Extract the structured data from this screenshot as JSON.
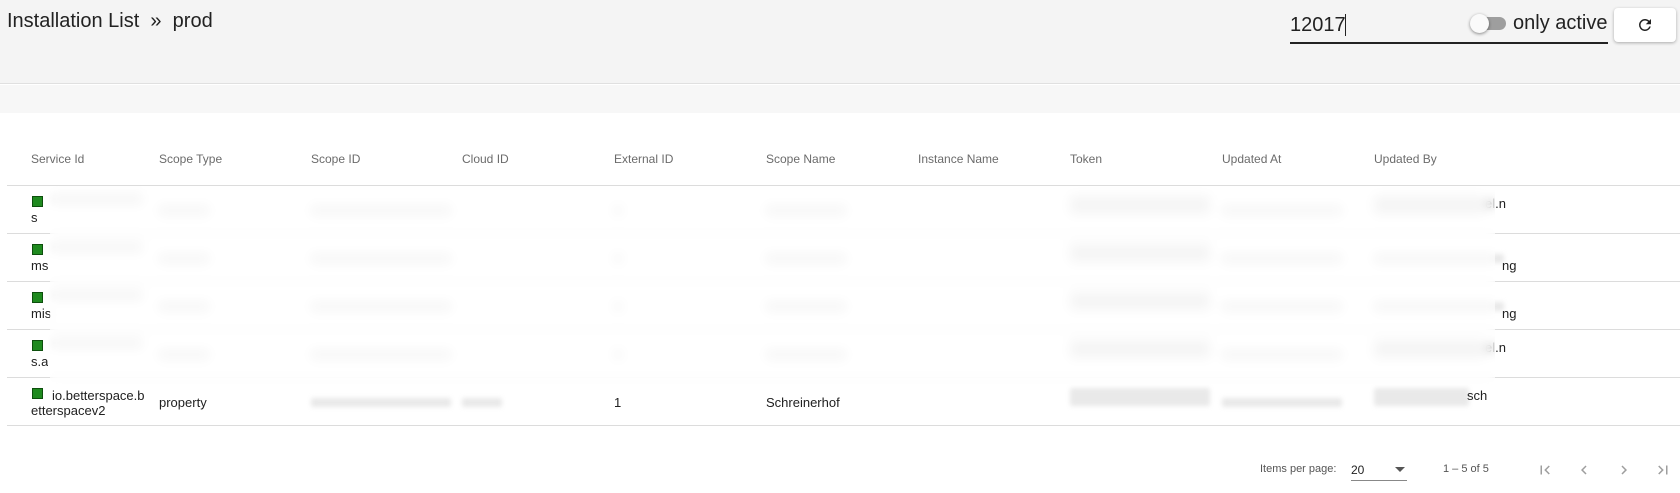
{
  "header": {
    "breadcrumb_root": "Installation List",
    "breadcrumb_sep": "»",
    "breadcrumb_env": "prod",
    "search_value": "12017",
    "toggle_label": "only active",
    "toggle_on": false
  },
  "table": {
    "columns": [
      "Service Id",
      "Scope Type",
      "Scope ID",
      "Cloud ID",
      "External ID",
      "Scope Name",
      "Instance Name",
      "Token",
      "Updated At",
      "Updated By"
    ],
    "rows": [
      {
        "service_visible": "s",
        "updated_by_visible": "el.n",
        "blurred": true
      },
      {
        "service_visible": "ms",
        "updated_by_visible": "ng",
        "blurred": true
      },
      {
        "service_visible": "mis",
        "updated_by_visible": "ng",
        "blurred": true
      },
      {
        "service_visible": "s.a",
        "updated_by_visible": "el.n",
        "blurred": true
      },
      {
        "service_line1": "io.betterspace.b",
        "service_line2": "etterspacev2",
        "scope_type": "property",
        "external_id": "1",
        "scope_name": "Schreinerhof",
        "updated_by_visible": "sch",
        "blurred": false
      }
    ],
    "status_color": "#1f8a1f"
  },
  "paginator": {
    "items_per_page_label": "Items per page:",
    "items_per_page_value": "20",
    "range_label": "1 – 5 of 5"
  }
}
